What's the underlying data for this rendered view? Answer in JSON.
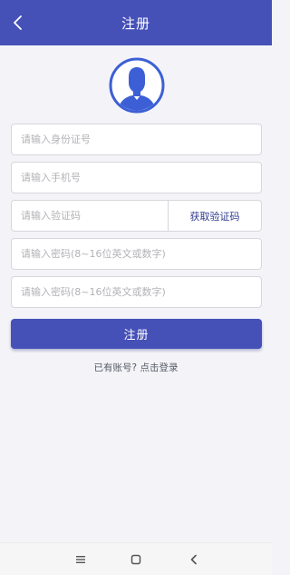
{
  "header": {
    "title": "注册",
    "back_icon": "chevron-left-icon"
  },
  "avatar": {
    "icon": "user-avatar-icon",
    "color": "#3d5fd6"
  },
  "form": {
    "id_number": {
      "placeholder": "请输入身份证号",
      "value": ""
    },
    "phone": {
      "placeholder": "请输入手机号",
      "value": ""
    },
    "verification_code": {
      "placeholder": "请输入验证码",
      "value": "",
      "button_label": "获取验证码"
    },
    "password": {
      "placeholder": "请输入密码(8~16位英文或数字)",
      "value": ""
    },
    "confirm_password": {
      "placeholder": "请输入密码(8~16位英文或数字)",
      "value": ""
    }
  },
  "register_button": {
    "label": "注册"
  },
  "login_link": {
    "label": "已有账号? 点击登录"
  },
  "system_nav": {
    "menu_icon": "menu-icon",
    "home_icon": "home-square-icon",
    "back_icon": "back-triangle-icon"
  },
  "colors": {
    "primary": "#4651b8",
    "background": "#f4f4f8"
  }
}
